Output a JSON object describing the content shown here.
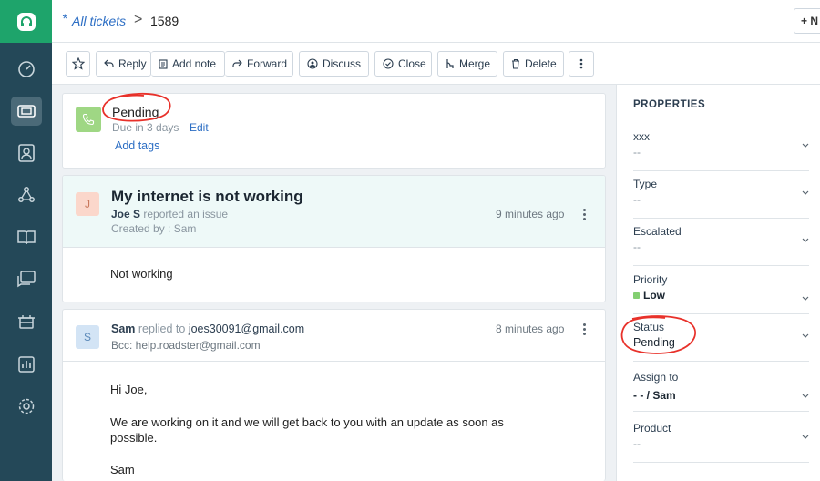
{
  "header": {
    "breadcrumb_star": "*",
    "breadcrumb_link": "All tickets",
    "breadcrumb_sep": ">",
    "ticket_id": "1589",
    "new_button": "+ N"
  },
  "toolbar": {
    "reply": "Reply",
    "add_note": "Add note",
    "forward": "Forward",
    "discuss": "Discuss",
    "close": "Close",
    "merge": "Merge",
    "delete": "Delete"
  },
  "status_card": {
    "status": "Pending",
    "due": "Due in 3 days",
    "edit": "Edit",
    "add_tags": "Add tags"
  },
  "ticket": {
    "avatar": "J",
    "subject": "My internet is not working",
    "requester": "Joe S",
    "action": "reported an issue",
    "created_by": "Created by : Sam",
    "time": "9 minutes ago",
    "body": "Not working"
  },
  "reply": {
    "avatar": "S",
    "agent": "Sam",
    "action": "replied to",
    "to": "joes30091@gmail.com",
    "bcc": "Bcc:  help.roadster@gmail.com",
    "time": "8 minutes ago",
    "greeting": "Hi Joe,",
    "message_line1": "We are working on it and we will get back to you with an update as soon as",
    "message_line2": "possible.",
    "signature": "Sam"
  },
  "properties": {
    "title": "PROPERTIES",
    "fields": [
      {
        "label": "xxx",
        "value": "--"
      },
      {
        "label": "Type",
        "value": "--"
      },
      {
        "label": "Escalated",
        "value": "--"
      },
      {
        "label": "Priority",
        "value": "Low"
      },
      {
        "label": "Status",
        "value": "Pending"
      },
      {
        "label": "Assign to",
        "value": "- - / Sam"
      },
      {
        "label": "Product",
        "value": "--"
      }
    ]
  },
  "colors": {
    "brand_green": "#1ea46b",
    "rail": "#244858",
    "link_blue": "#2c6ec4",
    "annotation_red": "#e8312a",
    "priority_low": "#83cf72"
  },
  "icons": {
    "rail": [
      "headset-logo-icon",
      "dashboard-icon",
      "tickets-icon",
      "contacts-icon",
      "social-icon",
      "knowledge-base-icon",
      "forums-icon",
      "freddy-icon",
      "reports-icon",
      "settings-icon"
    ]
  }
}
